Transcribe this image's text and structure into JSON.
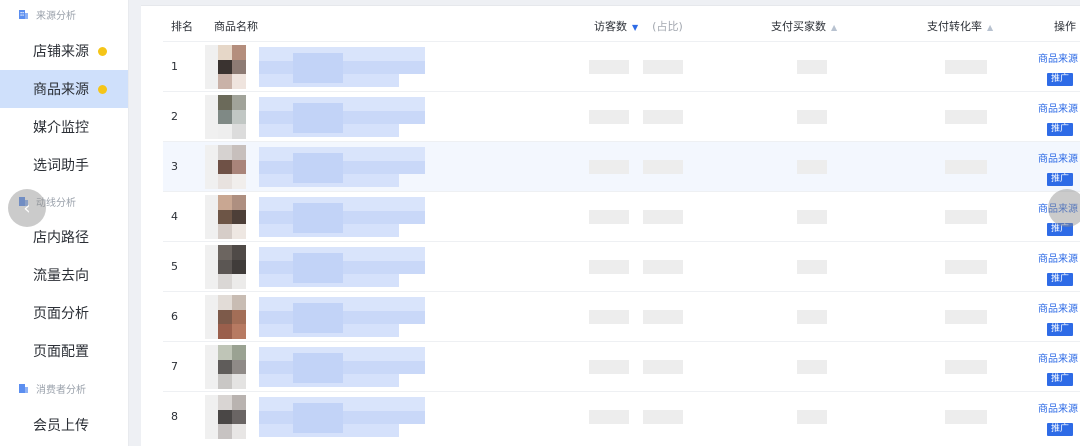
{
  "sidebar": {
    "group_source": "来源分析",
    "group_traffic": "动线分析",
    "group_consumer": "消费者分析",
    "items": [
      {
        "label": "店铺来源",
        "dot": true
      },
      {
        "label": "商品来源",
        "dot": true,
        "active": true
      },
      {
        "label": "媒介监控"
      },
      {
        "label": "选词助手"
      },
      {
        "label": "店内路径"
      },
      {
        "label": "流量去向"
      },
      {
        "label": "页面分析"
      },
      {
        "label": "页面配置"
      },
      {
        "label": "会员上传"
      }
    ]
  },
  "table": {
    "headers": {
      "rank": "排名",
      "product": "商品名称",
      "visitors": "访客数",
      "visitors_ratio": "(占比)",
      "buyers": "支付买家数",
      "conversion": "支付转化率",
      "action": "操作"
    },
    "rows": [
      {
        "rank": "1"
      },
      {
        "rank": "2"
      },
      {
        "rank": "3"
      },
      {
        "rank": "4"
      },
      {
        "rank": "5"
      },
      {
        "rank": "6"
      },
      {
        "rank": "7"
      },
      {
        "rank": "8"
      }
    ],
    "action_link": "商品来源",
    "action_badge": "推广"
  },
  "colors": {
    "accent": "#2e6be6",
    "active_bg": "#cfe0fb",
    "dot": "#f5c518"
  }
}
